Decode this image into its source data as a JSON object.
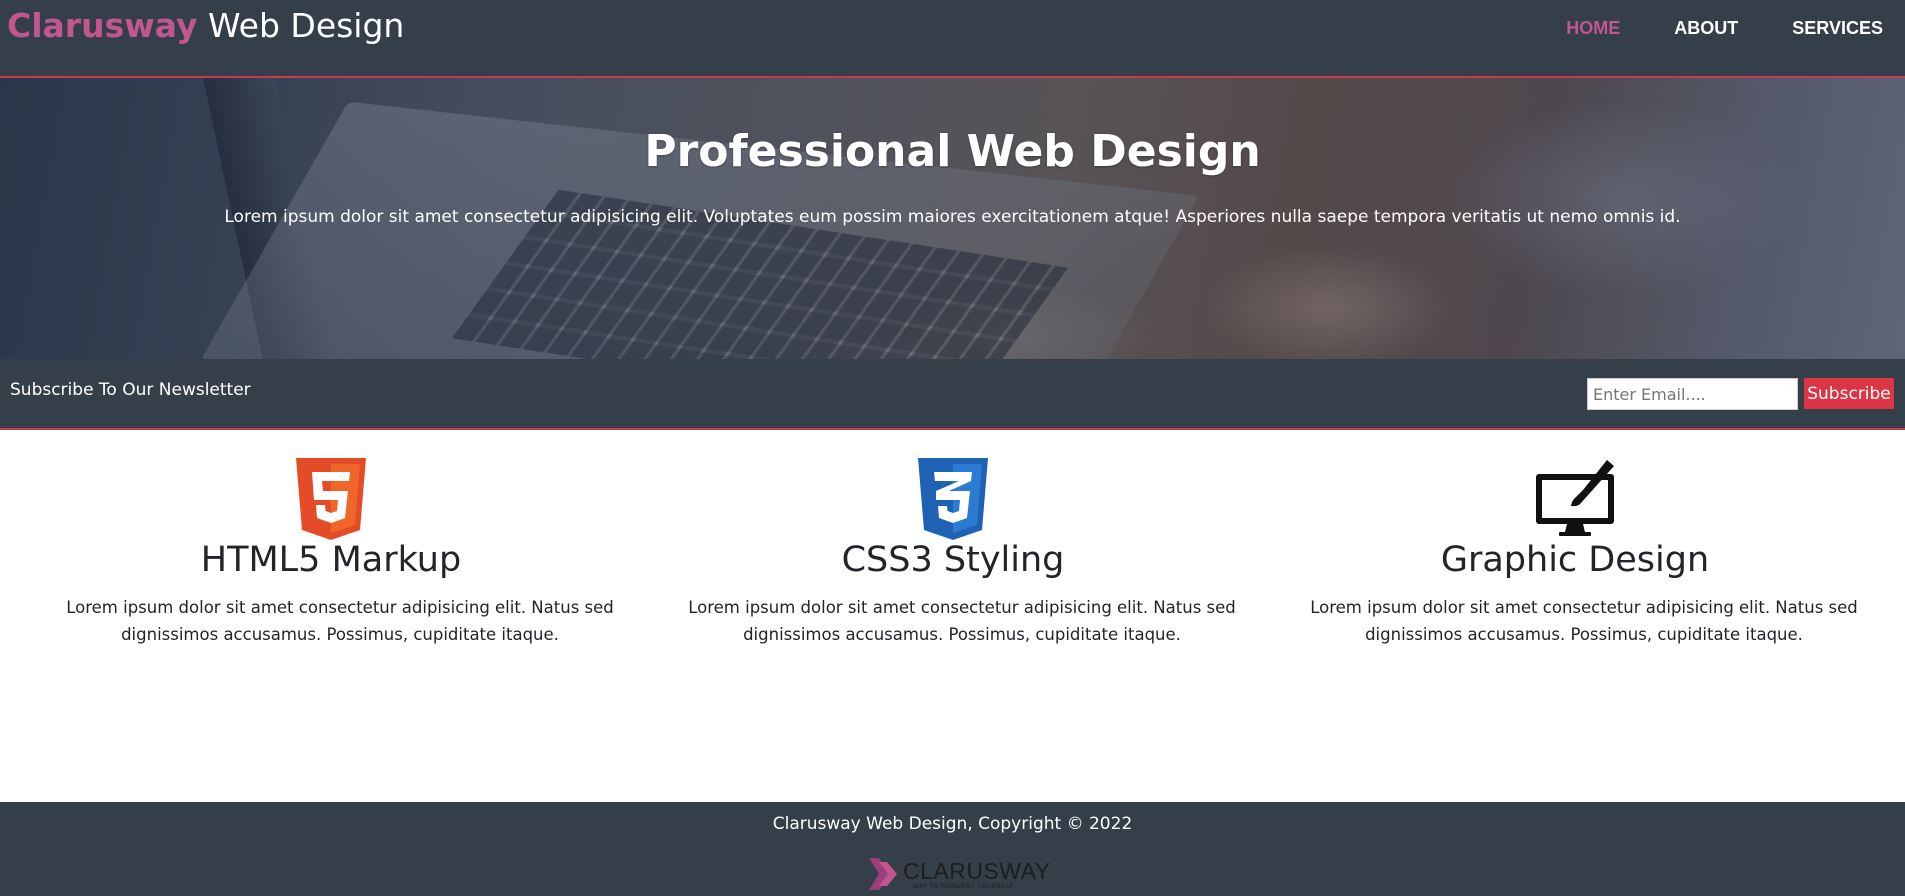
{
  "header": {
    "brand_accent": "Clarusway",
    "brand_rest": "Web Design",
    "nav": [
      {
        "label": "HOME",
        "active": true
      },
      {
        "label": "ABOUT",
        "active": false
      },
      {
        "label": "SERVICES",
        "active": false
      }
    ]
  },
  "hero": {
    "title": "Professional Web Design",
    "text": "Lorem ipsum dolor sit amet consectetur adipisicing elit. Voluptates eum possim maiores exercitationem atque! Asperiores nulla saepe tempora veritatis ut nemo omnis id."
  },
  "newsletter": {
    "label": "Subscribe To Our Newsletter",
    "email_placeholder": "Enter Email....",
    "email_value": "",
    "button_label": "Subscribe"
  },
  "features": [
    {
      "icon": "html5-icon",
      "title": "HTML5 Markup",
      "text": "Lorem ipsum dolor sit amet consectetur adipisicing elit. Natus sed dignissimos accusamus. Possimus, cupiditate itaque."
    },
    {
      "icon": "css3-icon",
      "title": "CSS3 Styling",
      "text": "Lorem ipsum dolor sit amet consectetur adipisicing elit. Natus sed dignissimos accusamus. Possimus, cupiditate itaque."
    },
    {
      "icon": "graphic-design-icon",
      "title": "Graphic Design",
      "text": "Lorem ipsum dolor sit amet consectetur adipisicing elit. Natus sed dignissimos accusamus. Possimus, cupiditate itaque."
    }
  ],
  "footer": {
    "copyright": "Clarusway Web Design, Copyright © 2022",
    "logo_name": "CLARUSWAY",
    "logo_tagline": "WAY TO REINVENT YOURSELF"
  },
  "colors": {
    "header_bg": "#343f4a",
    "accent_pink": "#c2568f",
    "accent_red": "#dc3545",
    "divider_red": "#c73a52"
  }
}
